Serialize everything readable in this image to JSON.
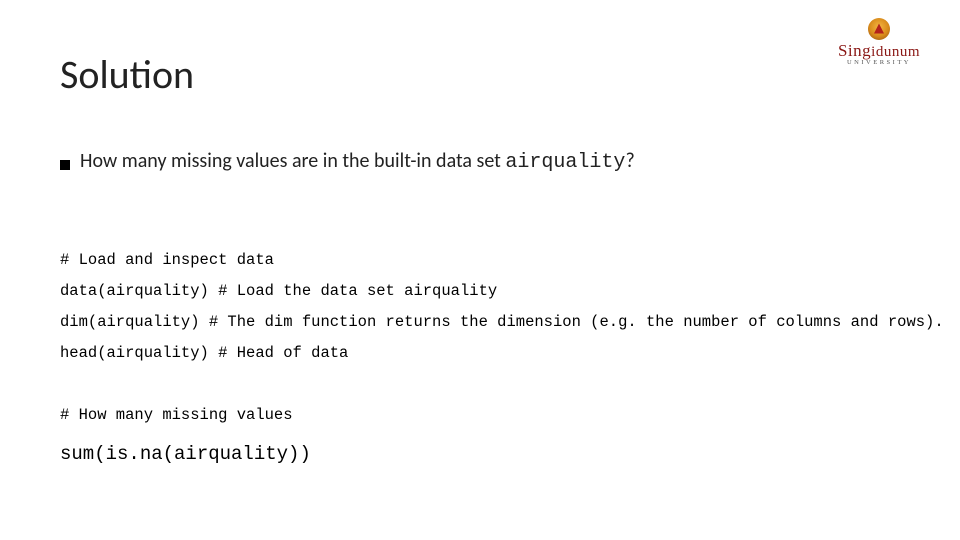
{
  "logo": {
    "name_part1": "Sing",
    "name_part2": "i",
    "name_part3": "dunum",
    "subtitle": "UNIVERSITY"
  },
  "title": "Solution",
  "bullet": {
    "prefix": "How many missing values are in the built-in data set ",
    "code_word": "airquality",
    "suffix": "?"
  },
  "code": {
    "l1": "# Load and inspect data",
    "l2": "data(airquality) # Load the data set airquality",
    "l3": "dim(airquality) # The dim function returns the dimension (e.g. the number of columns and rows).",
    "l4": "head(airquality) # Head of data",
    "l5": "# How many missing values",
    "l6": "sum(is.na(airquality))"
  }
}
